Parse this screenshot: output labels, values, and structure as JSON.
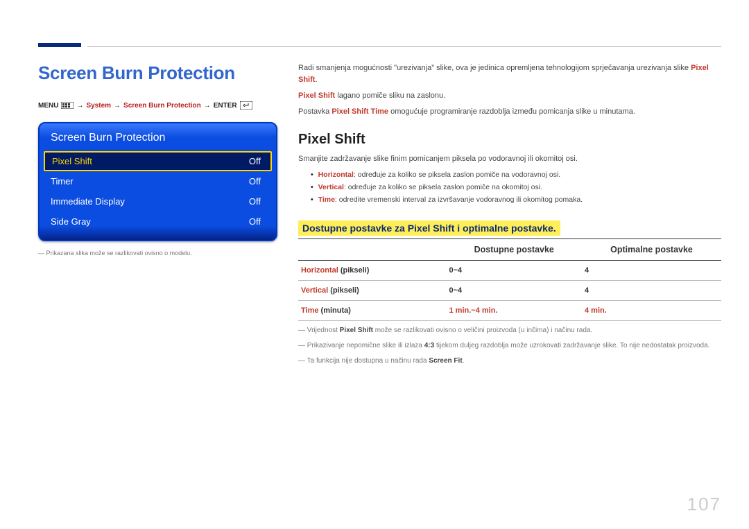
{
  "page_number": "107",
  "left": {
    "title": "Screen Burn Protection",
    "crumbs": {
      "menu": "MENU",
      "system": "System",
      "sbp": "Screen Burn Protection",
      "enter": "ENTER"
    },
    "menu": {
      "title": "Screen Burn Protection",
      "rows": [
        {
          "label": "Pixel Shift",
          "value": "Off",
          "selected": true
        },
        {
          "label": "Timer",
          "value": "Off",
          "selected": false
        },
        {
          "label": "Immediate Display",
          "value": "Off",
          "selected": false
        },
        {
          "label": "Side Gray",
          "value": "Off",
          "selected": false
        }
      ]
    },
    "note": "Prikazana slika može se razlikovati ovisno o modelu."
  },
  "right": {
    "p1_a": "Radi smanjenja mogućnosti \"urezivanja\" slike, ova je jedinica opremljena tehnologijom sprječavanja urezivanja slike ",
    "p1_hl": "Pixel Shift",
    "p1_b": ".",
    "p2_hl": "Pixel Shift",
    "p2_b": " lagano pomiče sliku na zaslonu.",
    "p3_a": "Postavka ",
    "p3_hl": "Pixel Shift Time",
    "p3_b": " omogućuje programiranje razdoblja između pomicanja slike u minutama.",
    "h2": "Pixel Shift",
    "p4": "Smanjite zadržavanje slike finim pomicanjem piksela po vodoravnoj ili okomitoj osi.",
    "bullets": [
      {
        "hl": "Horizontal",
        "rest": ": određuje za koliko se piksela zaslon pomiče na vodoravnoj osi."
      },
      {
        "hl": "Vertical",
        "rest": ": određuje za koliko se piksela zaslon pomiče na okomitoj osi."
      },
      {
        "hl": "Time",
        "rest": ": odredite vremenski interval za izvršavanje vodoravnog ili okomitog pomaka."
      }
    ],
    "subhead": "Dostupne postavke za Pixel Shift i optimalne postavke.",
    "table": {
      "headers": [
        "",
        "Dostupne postavke",
        "Optimalne postavke"
      ],
      "rows": [
        {
          "name_hl": "Horizontal",
          "name_rest": " (pikseli)",
          "avail": "0~4",
          "opt": "4",
          "opt_is_red": false,
          "avail_is_red": false
        },
        {
          "name_hl": "Vertical",
          "name_rest": " (pikseli)",
          "avail": "0~4",
          "opt": "4",
          "opt_is_red": false,
          "avail_is_red": false
        },
        {
          "name_hl": "Time",
          "name_rest": " (minuta)",
          "avail": "1 min.~4 min.",
          "opt": "4 min.",
          "opt_is_red": true,
          "avail_is_red": true
        }
      ]
    },
    "notes": [
      {
        "a": "Vrijednost ",
        "b1": "Pixel Shift",
        "c": " može se razlikovati ovisno o veličini proizvoda (u inčima) i načinu rada."
      },
      {
        "a": "Prikazivanje nepomične slike ili izlaza ",
        "b1": "4:3",
        "c": " tijekom duljeg razdoblja može uzrokovati zadržavanje slike. To nije nedostatak proizvoda."
      },
      {
        "a": "Ta funkcija nije dostupna u načinu rada ",
        "b1": "Screen Fit",
        "c": "."
      }
    ]
  }
}
